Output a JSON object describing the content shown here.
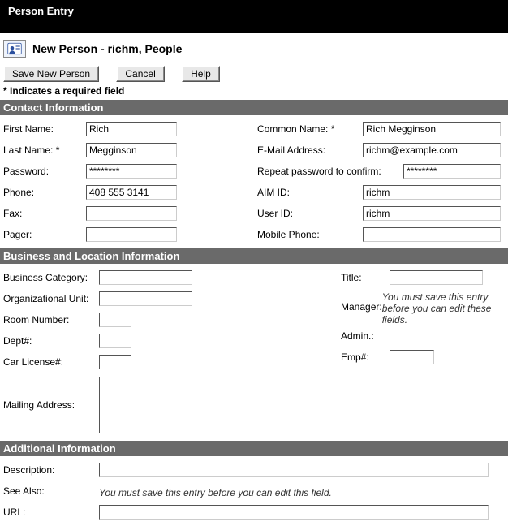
{
  "window": {
    "title": "Person Entry"
  },
  "header": {
    "title": "New Person - richm, People"
  },
  "toolbar": {
    "save": "Save New Person",
    "cancel": "Cancel",
    "help": "Help"
  },
  "required_note": "* Indicates a required field",
  "sections": {
    "contact": {
      "title": "Contact Information",
      "left": {
        "first_name": {
          "label": "First Name:",
          "value": "Rich"
        },
        "last_name": {
          "label": "Last Name: *",
          "value": "Megginson"
        },
        "password": {
          "label": "Password:",
          "value": "********"
        },
        "phone": {
          "label": "Phone:",
          "value": "408 555 3141"
        },
        "fax": {
          "label": "Fax:",
          "value": ""
        },
        "pager": {
          "label": "Pager:",
          "value": ""
        }
      },
      "right": {
        "common_name": {
          "label": "Common Name: *",
          "value": "Rich Megginson"
        },
        "email": {
          "label": "E-Mail Address:",
          "value": "richm@example.com"
        },
        "repeat_pw": {
          "label": "Repeat password to confirm:",
          "value": "********"
        },
        "aim_id": {
          "label": "AIM ID:",
          "value": "richm"
        },
        "user_id": {
          "label": "User ID:",
          "value": "richm"
        },
        "mobile": {
          "label": "Mobile Phone:",
          "value": ""
        }
      }
    },
    "business": {
      "title": "Business and Location Information",
      "left": {
        "category": {
          "label": "Business Category:",
          "value": ""
        },
        "org_unit": {
          "label": "Organizational Unit:",
          "value": ""
        },
        "room": {
          "label": "Room Number:",
          "value": ""
        },
        "dept": {
          "label": "Dept#:",
          "value": ""
        },
        "car": {
          "label": "Car License#:",
          "value": ""
        },
        "mailing": {
          "label": "Mailing Address:",
          "value": ""
        }
      },
      "right": {
        "title_f": {
          "label": "Title:",
          "value": ""
        },
        "manager": {
          "label": "Manager:",
          "note": "You must save this entry before you can edit these fields."
        },
        "admin": {
          "label": "Admin.:"
        },
        "emp": {
          "label": "Emp#:",
          "value": ""
        }
      }
    },
    "additional": {
      "title": "Additional Information",
      "description": {
        "label": "Description:",
        "value": ""
      },
      "see_also": {
        "label": "See Also:",
        "note": "You must save this entry before you can edit this field."
      },
      "url": {
        "label": "URL:",
        "value": ""
      }
    }
  }
}
